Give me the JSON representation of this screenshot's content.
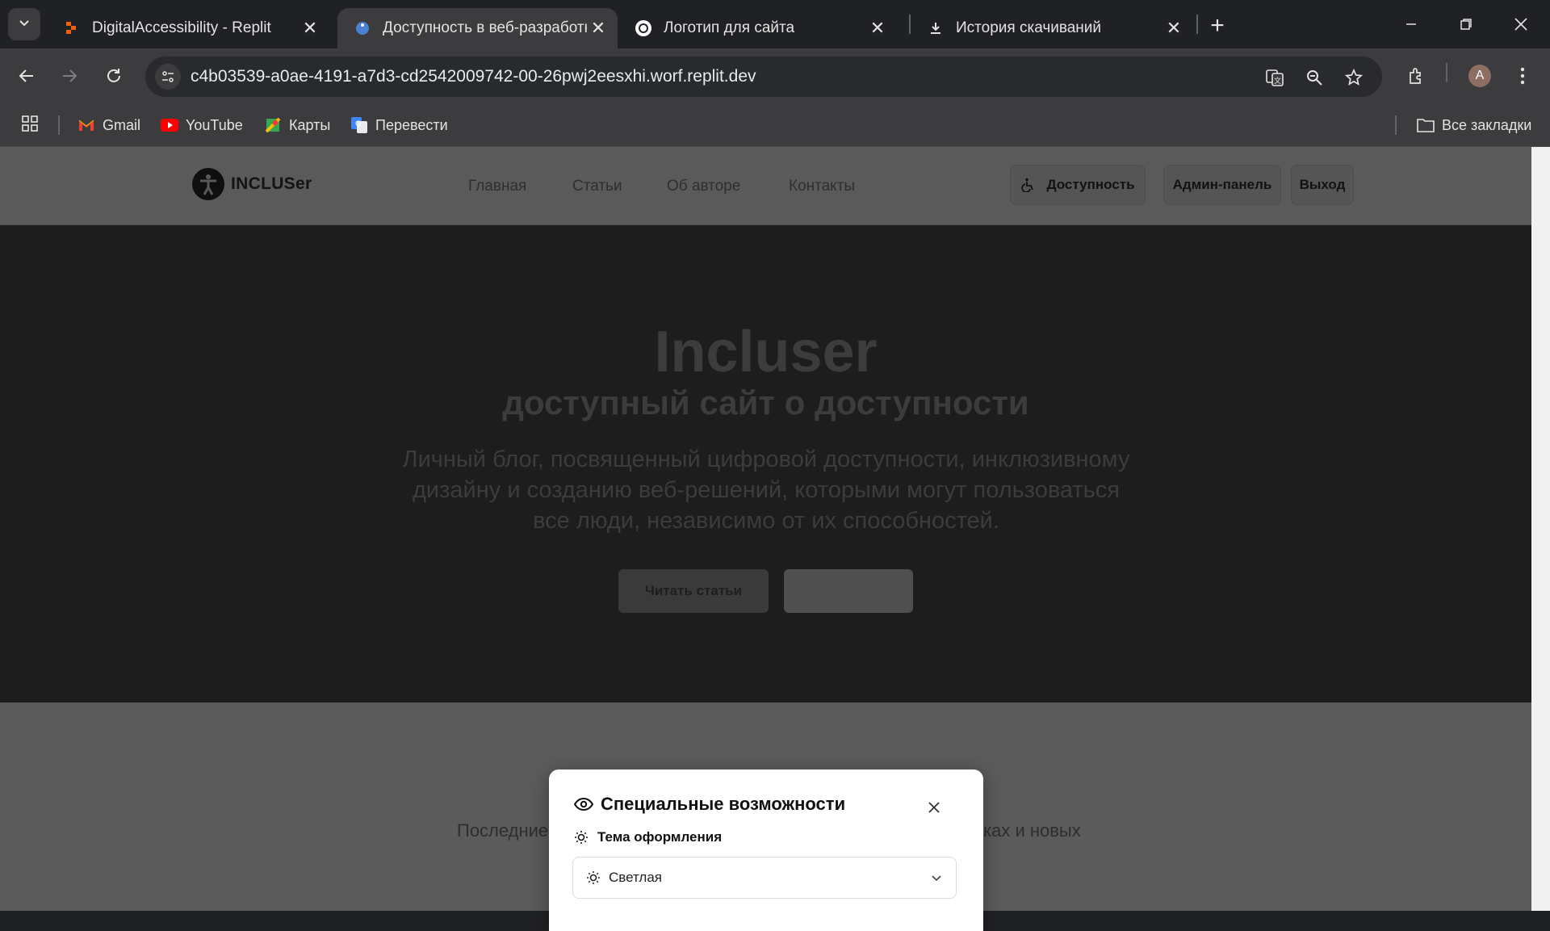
{
  "browser": {
    "tabs": [
      {
        "title": "DigitalAccessibility - Replit",
        "active": false
      },
      {
        "title": "Доступность в веб-разработке",
        "active": true
      },
      {
        "title": "Логотип для сайта",
        "active": false
      },
      {
        "title": "История скачиваний",
        "active": false
      }
    ],
    "url": "c4b03539-a0ae-4191-a7d3-cd2542009742-00-26pwj2eesxhi.worf.replit.dev",
    "profile_initial": "A",
    "bookmarks": [
      {
        "label": "Gmail"
      },
      {
        "label": "YouTube"
      },
      {
        "label": "Карты"
      },
      {
        "label": "Перевести"
      }
    ],
    "all_bookmarks_label": "Все закладки"
  },
  "site": {
    "logo_text": "INCLUSer",
    "nav": [
      "Главная",
      "Статьи",
      "Об авторе",
      "Контакты"
    ],
    "accessibility_button": "Доступность",
    "admin_button": "Админ-панель",
    "logout_button": "Выход",
    "hero": {
      "title": "Incluser",
      "subtitle": "доступный сайт о доступности",
      "description": "Личный блог, посвященный цифровой доступности, инклюзивному дизайну и созданию веб-решений, которыми могут пользоваться все люди, независимо от их способностей.",
      "primary_button": "Читать статьи"
    },
    "section_text_left": "Последние",
    "section_text_right": "ках и новых"
  },
  "dialog": {
    "title": "Специальные возможности",
    "theme_label": "Тема оформления",
    "theme_value": "Светлая"
  },
  "colors": {
    "chrome_bg": "#202124",
    "toolbar_bg": "#3c3c3f",
    "hero_bg": "#1d1d1d",
    "overlay_gray": "#5b5b5b",
    "dialog_bg": "#ffffff"
  }
}
